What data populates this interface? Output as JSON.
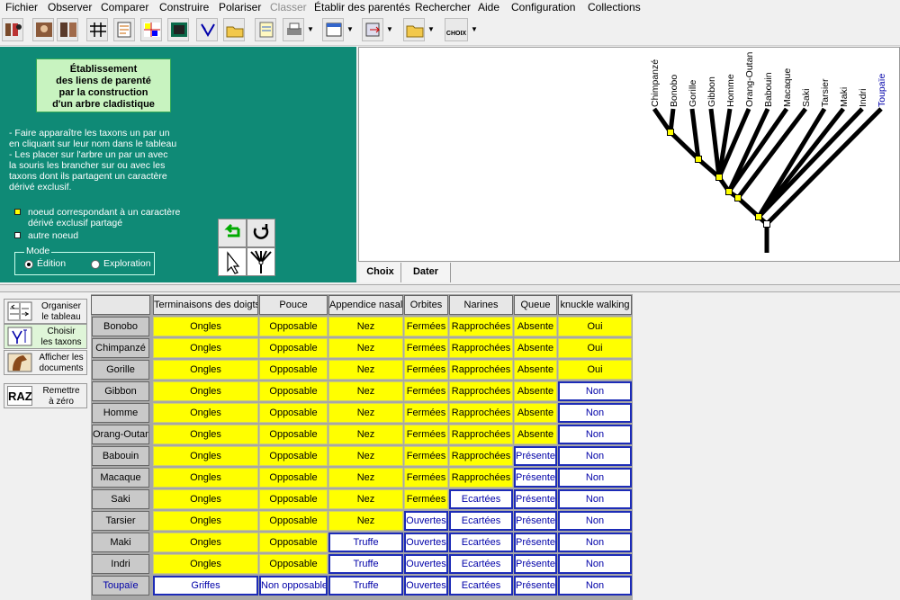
{
  "menu": [
    "Fichier",
    "Observer",
    "Comparer",
    "Construire",
    "Polariser",
    "Classer",
    "Établir des parentés",
    "Rechercher",
    "Aide",
    "Configuration",
    "Collections"
  ],
  "toolbar": {
    "choix_label": "CHOIX"
  },
  "left_panel": {
    "title": "Établissement\ndes liens de parenté\npar la construction\nd'un arbre cladistique",
    "instructions": "- Faire apparaître les taxons un par un\n  en cliquant sur  leur nom dans le tableau\n- Les placer sur l'arbre un par un avec\n  la souris les brancher sur ou avec les\n  taxons dont ils partagent un caractère\n  dérivé exclusif.",
    "legend_yellow": "noeud correspondant à un caractère",
    "legend_yellow2": "dérivé exclusif partagé",
    "legend_white": "autre noeud",
    "mode_label": "Mode",
    "mode_edit": "Édition",
    "mode_explore": "Exploration",
    "node_yellow_color": "#ffff00"
  },
  "tree": {
    "taxa": [
      "Chimpanzé",
      "Bonobo",
      "Gorille",
      "Gibbon",
      "Homme",
      "Orang-Outan",
      "Babouin",
      "Macaque",
      "Saki",
      "Tarsier",
      "Maki",
      "Indri",
      "Toupaïe"
    ],
    "highlight_taxon": "Toupaïe"
  },
  "tabs": [
    "Choix",
    "Dater"
  ],
  "side_buttons": [
    {
      "label": "Organiser\nle tableau",
      "icon": "organize-icon"
    },
    {
      "label": "Choisir\nles taxons",
      "icon": "tree-icon"
    },
    {
      "label": "Afficher les\ndocuments",
      "icon": "horse-icon"
    },
    {
      "label": "Remettre\nà zéro",
      "icon": "raz-icon",
      "icon_text": "RAZ"
    }
  ],
  "table": {
    "columns": [
      "Terminaisons des doigts",
      "Pouce",
      "Appendice nasal",
      "Orbites",
      "Narines",
      "Queue",
      "knuckle walking"
    ],
    "rows": [
      {
        "taxon": "Bonobo",
        "cells": [
          "Ongles",
          "Opposable",
          "Nez",
          "Fermées",
          "Rapprochées",
          "Absente",
          "Oui"
        ],
        "derived": [
          1,
          1,
          1,
          1,
          1,
          1,
          1
        ]
      },
      {
        "taxon": "Chimpanzé",
        "cells": [
          "Ongles",
          "Opposable",
          "Nez",
          "Fermées",
          "Rapprochées",
          "Absente",
          "Oui"
        ],
        "derived": [
          1,
          1,
          1,
          1,
          1,
          1,
          1
        ]
      },
      {
        "taxon": "Gorille",
        "cells": [
          "Ongles",
          "Opposable",
          "Nez",
          "Fermées",
          "Rapprochées",
          "Absente",
          "Oui"
        ],
        "derived": [
          1,
          1,
          1,
          1,
          1,
          1,
          1
        ]
      },
      {
        "taxon": "Gibbon",
        "cells": [
          "Ongles",
          "Opposable",
          "Nez",
          "Fermées",
          "Rapprochées",
          "Absente",
          "Non"
        ],
        "derived": [
          1,
          1,
          1,
          1,
          1,
          1,
          0
        ]
      },
      {
        "taxon": "Homme",
        "cells": [
          "Ongles",
          "Opposable",
          "Nez",
          "Fermées",
          "Rapprochées",
          "Absente",
          "Non"
        ],
        "derived": [
          1,
          1,
          1,
          1,
          1,
          1,
          0
        ]
      },
      {
        "taxon": "Orang-Outan",
        "cells": [
          "Ongles",
          "Opposable",
          "Nez",
          "Fermées",
          "Rapprochées",
          "Absente",
          "Non"
        ],
        "derived": [
          1,
          1,
          1,
          1,
          1,
          1,
          0
        ]
      },
      {
        "taxon": "Babouin",
        "cells": [
          "Ongles",
          "Opposable",
          "Nez",
          "Fermées",
          "Rapprochées",
          "Présente",
          "Non"
        ],
        "derived": [
          1,
          1,
          1,
          1,
          1,
          0,
          0
        ]
      },
      {
        "taxon": "Macaque",
        "cells": [
          "Ongles",
          "Opposable",
          "Nez",
          "Fermées",
          "Rapprochées",
          "Présente",
          "Non"
        ],
        "derived": [
          1,
          1,
          1,
          1,
          1,
          0,
          0
        ]
      },
      {
        "taxon": "Saki",
        "cells": [
          "Ongles",
          "Opposable",
          "Nez",
          "Fermées",
          "Ecartées",
          "Présente",
          "Non"
        ],
        "derived": [
          1,
          1,
          1,
          1,
          0,
          0,
          0
        ]
      },
      {
        "taxon": "Tarsier",
        "cells": [
          "Ongles",
          "Opposable",
          "Nez",
          "Ouvertes",
          "Ecartées",
          "Présente",
          "Non"
        ],
        "derived": [
          1,
          1,
          1,
          0,
          0,
          0,
          0
        ]
      },
      {
        "taxon": "Maki",
        "cells": [
          "Ongles",
          "Opposable",
          "Truffe",
          "Ouvertes",
          "Ecartées",
          "Présente",
          "Non"
        ],
        "derived": [
          1,
          1,
          0,
          0,
          0,
          0,
          0
        ]
      },
      {
        "taxon": "Indri",
        "cells": [
          "Ongles",
          "Opposable",
          "Truffe",
          "Ouvertes",
          "Ecartées",
          "Présente",
          "Non"
        ],
        "derived": [
          1,
          1,
          0,
          0,
          0,
          0,
          0
        ]
      },
      {
        "taxon": "Toupaïe",
        "cells": [
          "Griffes",
          "Non opposable",
          "Truffe",
          "Ouvertes",
          "Ecartées",
          "Présente",
          "Non"
        ],
        "derived": [
          0,
          0,
          0,
          0,
          0,
          0,
          0
        ]
      }
    ]
  }
}
